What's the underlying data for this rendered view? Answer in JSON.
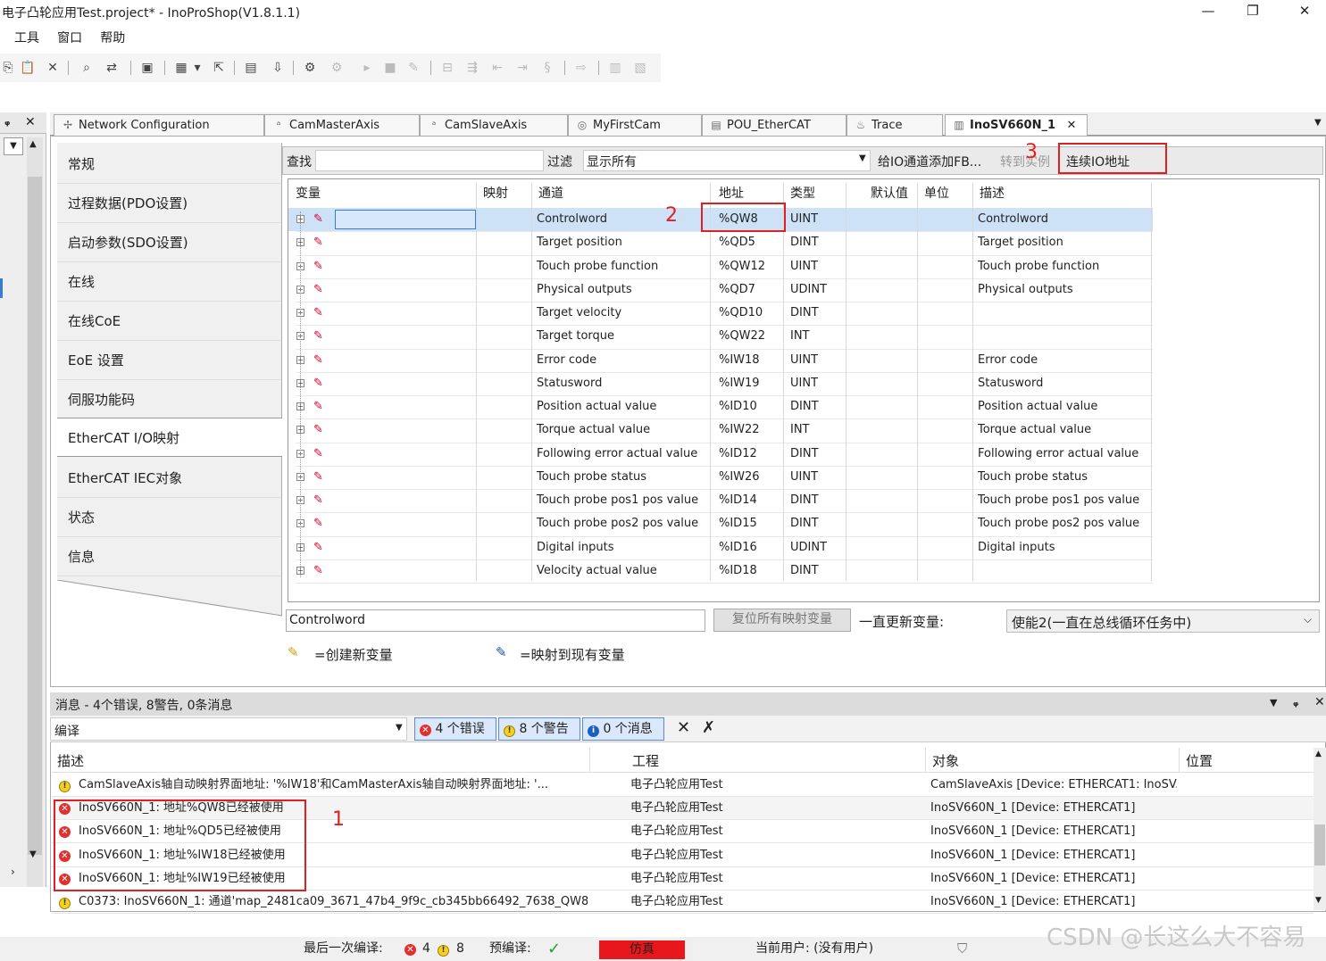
{
  "window": {
    "title": "电子凸轮应用Test.project* - InoProShop(V1.8.1.1)",
    "min": "—",
    "max": "❐",
    "close": "✕"
  },
  "menu": [
    "工具",
    "窗口",
    "帮助"
  ],
  "left_panel": {
    "pin": "ᵩ",
    "close": "✕"
  },
  "tabs": [
    {
      "label": "Network Configuration"
    },
    {
      "label": "CamMasterAxis"
    },
    {
      "label": "CamSlaveAxis"
    },
    {
      "label": "MyFirstCam"
    },
    {
      "label": "POU_EtherCAT"
    },
    {
      "label": "Trace"
    },
    {
      "label": "InoSV660N_1"
    }
  ],
  "tab_close": "✕",
  "nav": [
    "常规",
    "过程数据(PDO设置)",
    "启动参数(SDO设置)",
    "在线",
    "在线CoE",
    "EoE 设置",
    "伺服功能码",
    "EtherCAT I/O映射",
    "EtherCAT IEC对象",
    "状态",
    "信息"
  ],
  "filter": {
    "find_label": "查找",
    "filter_label": "过滤",
    "filter_value": "显示所有",
    "add_fb": "给IO通道添加FB...",
    "goto_instance": "转到实例",
    "continuous_io": "连续IO地址"
  },
  "grid": {
    "headers": [
      "变量",
      "映射",
      "通道",
      "地址",
      "类型",
      "默认值",
      "单位",
      "描述"
    ],
    "rows": [
      {
        "channel": "Controlword",
        "address": "%QW8",
        "type": "UINT",
        "desc": "Controlword"
      },
      {
        "channel": "Target position",
        "address": "%QD5",
        "type": "DINT",
        "desc": "Target position"
      },
      {
        "channel": "Touch probe function",
        "address": "%QW12",
        "type": "UINT",
        "desc": "Touch probe function"
      },
      {
        "channel": "Physical outputs",
        "address": "%QD7",
        "type": "UDINT",
        "desc": "Physical outputs"
      },
      {
        "channel": "Target velocity",
        "address": "%QD10",
        "type": "DINT",
        "desc": ""
      },
      {
        "channel": "Target torque",
        "address": "%QW22",
        "type": "INT",
        "desc": ""
      },
      {
        "channel": "Error code",
        "address": "%IW18",
        "type": "UINT",
        "desc": "Error code"
      },
      {
        "channel": "Statusword",
        "address": "%IW19",
        "type": "UINT",
        "desc": "Statusword"
      },
      {
        "channel": "Position actual value",
        "address": "%ID10",
        "type": "DINT",
        "desc": "Position actual value"
      },
      {
        "channel": "Torque actual value",
        "address": "%IW22",
        "type": "INT",
        "desc": "Torque actual value"
      },
      {
        "channel": "Following error actual value",
        "address": "%ID12",
        "type": "DINT",
        "desc": "Following error actual value"
      },
      {
        "channel": "Touch probe status",
        "address": "%IW26",
        "type": "UINT",
        "desc": "Touch probe status"
      },
      {
        "channel": "Touch probe pos1 pos value",
        "address": "%ID14",
        "type": "DINT",
        "desc": "Touch probe pos1 pos value"
      },
      {
        "channel": "Touch probe pos2 pos value",
        "address": "%ID15",
        "type": "DINT",
        "desc": "Touch probe pos2 pos value"
      },
      {
        "channel": "Digital inputs",
        "address": "%ID16",
        "type": "UDINT",
        "desc": "Digital inputs"
      },
      {
        "channel": "Velocity actual value",
        "address": "%ID18",
        "type": "DINT",
        "desc": ""
      }
    ]
  },
  "bottom": {
    "selected_channel": "Controlword",
    "reset_btn": "复位所有映射变量",
    "always_update_label": "一直更新变量:",
    "always_update_value": "使能2(一直在总线循环任务中)",
    "legend_new": "=创建新变量",
    "legend_map": "=映射到现有变量"
  },
  "annotations": {
    "n1": "1",
    "n2": "2",
    "n3": "3"
  },
  "messages": {
    "title": "消息 - 4个错误, 8警告, 0条消息",
    "source": "编译",
    "errors_btn": "4 个错误",
    "warnings_btn": "8 个警告",
    "messages_btn": "0 个消息",
    "headers": [
      "描述",
      "工程",
      "对象",
      "位置"
    ],
    "rows": [
      {
        "kind": "warn",
        "desc": "CamSlaveAxis轴自动映射界面地址: '%IW18'和CamMasterAxis轴自动映射界面地址: '...",
        "project": "电子凸轮应用Test",
        "object": "CamSlaveAxis [Device: ETHERCAT1: InoSV..."
      },
      {
        "kind": "err",
        "desc": "InoSV660N_1: 地址%QW8已经被使用",
        "project": "电子凸轮应用Test",
        "object": "InoSV660N_1 [Device: ETHERCAT1]"
      },
      {
        "kind": "err",
        "desc": "InoSV660N_1: 地址%QD5已经被使用",
        "project": "电子凸轮应用Test",
        "object": "InoSV660N_1 [Device: ETHERCAT1]"
      },
      {
        "kind": "err",
        "desc": "InoSV660N_1: 地址%IW18已经被使用",
        "project": "电子凸轮应用Test",
        "object": "InoSV660N_1 [Device: ETHERCAT1]"
      },
      {
        "kind": "err",
        "desc": "InoSV660N_1: 地址%IW19已经被使用",
        "project": "电子凸轮应用Test",
        "object": "InoSV660N_1 [Device: ETHERCAT1]"
      },
      {
        "kind": "warn",
        "desc": "C0373: InoSV660N_1: 通道'map_2481ca09_3671_47b4_9f9c_cb345bb66492_7638_QW8'...",
        "project": "电子凸轮应用Test",
        "object": "InoSV660N_1 [Device: ETHERCAT1]"
      }
    ]
  },
  "status": {
    "last_compile": "最后一次编译:",
    "err_count": "4",
    "warn_count": "8",
    "precompile": "预编译:",
    "sim": "仿真",
    "user": "当前用户: (没有用户)",
    "watermark": "CSDN @长这么大不容易"
  },
  "colors": {
    "accent_red": "#e02020",
    "sim_bg": "#e8171b",
    "selected_row": "#cde2f6"
  }
}
